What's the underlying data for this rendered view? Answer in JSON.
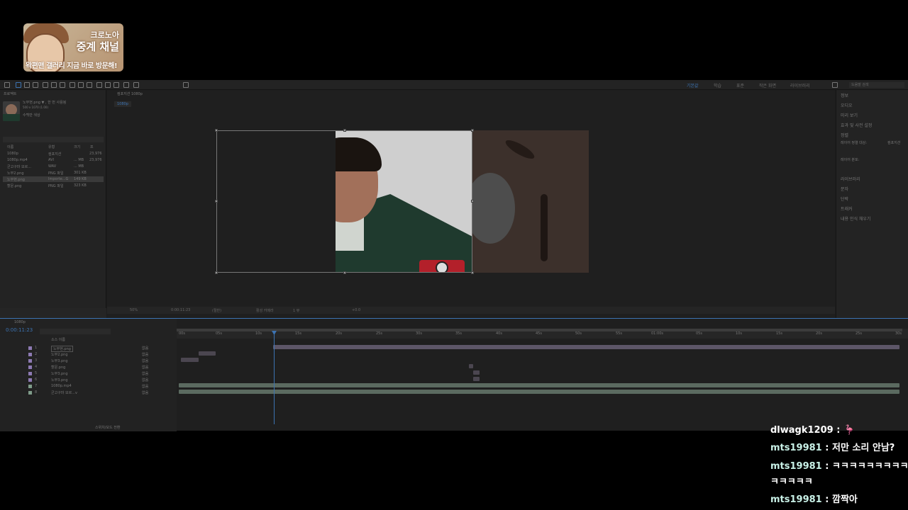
{
  "overlay": {
    "logo_line1": "크로노아",
    "logo_line2": "중계 채널",
    "logo_line3": "왁편맨 갤러리 지금 바로 방문해!"
  },
  "toolbar": {
    "workspaces": [
      "기본값",
      "학습",
      "표준",
      "작은 화면",
      "라이브러리"
    ],
    "active_workspace": "기본값",
    "search_placeholder": "도움말 검색"
  },
  "project_panel": {
    "title": "프로젝트",
    "selected_name": "노무현.png ▼ , 한 번 사용됨",
    "selected_info": "500 x 1070 (1.00)",
    "selected_sub": "수백만 색상",
    "columns": [
      "이름",
      "유형",
      "크기",
      "프"
    ],
    "items": [
      {
        "name": "1080p",
        "type": "컴포지션",
        "size": "",
        "dur": "23,976"
      },
      {
        "name": "1080p.mp4",
        "type": "AVI",
        "size": "... MB",
        "dur": "23,976"
      },
      {
        "name": "군고구마 모르...",
        "type": "WAV",
        "size": "... MB",
        "dur": ""
      },
      {
        "name": "노무2.png",
        "type": "PNG 파일",
        "size": "301 KB",
        "dur": ""
      },
      {
        "name": "노무현.png",
        "type": "Importe...G",
        "size": "149 KB",
        "dur": ""
      },
      {
        "name": "할문.png",
        "type": "PNG 파일",
        "size": "323 KB",
        "dur": ""
      }
    ]
  },
  "comp_panel": {
    "tab": "컴포지션 1080p",
    "crumb": "1080p",
    "zoom": "50%",
    "timecode": "0:00:11:23",
    "resolution": "(절반)",
    "camera": "활성 카메라",
    "views": "1 뷰",
    "offset": "+0.0"
  },
  "right_panel": {
    "items": [
      "정보",
      "오디오",
      "미리 보기",
      "효과 및 사전 설정",
      "정렬",
      "레이어 정렬 대상:",
      "컴포지션",
      "레이어 분포:",
      "라이브러리",
      "문자",
      "단락",
      "트래커",
      "내용 인식 채우기"
    ]
  },
  "timeline": {
    "tab": "1080p",
    "timecode": "0:00:11:23",
    "ruler": [
      "00s",
      "05s",
      "10s",
      "15s",
      "20s",
      "25s",
      "30s",
      "35s",
      "40s",
      "45s",
      "50s",
      "55s",
      "01:00s",
      "05s",
      "10s",
      "15s",
      "20s",
      "25s",
      "30s"
    ],
    "header": "소스 이름",
    "parent_label": "없음",
    "layers": [
      {
        "num": "1",
        "name": "노무현.png",
        "color": "#8d7ab3"
      },
      {
        "num": "2",
        "name": "노무2.png",
        "color": "#8d7ab3"
      },
      {
        "num": "3",
        "name": "노무3.png",
        "color": "#8d7ab3"
      },
      {
        "num": "4",
        "name": "할문.png",
        "color": "#8d7ab3"
      },
      {
        "num": "5",
        "name": "노무3.png",
        "color": "#8d7ab3"
      },
      {
        "num": "6",
        "name": "노무3.png",
        "color": "#8d7ab3"
      },
      {
        "num": "7",
        "name": "1080p.mp4",
        "color": "#7f9c8a"
      },
      {
        "num": "8",
        "name": "군고구마 모르...v",
        "color": "#7f9c8a"
      }
    ],
    "footer": "스위치/모드 전환"
  },
  "chat": [
    {
      "user": "dlwagk1209",
      "sep": " : ",
      "msg": "🦩",
      "color": "#ffffff"
    },
    {
      "user": "mts19981",
      "sep": " : ",
      "msg": "저만 소리 안남?",
      "color": "#c8f0e6"
    },
    {
      "user": "mts19981",
      "sep": " : ",
      "msg": "ㅋㅋㅋㅋㅋㅋㅋㅋㅋ",
      "color": "#c8f0e6"
    },
    {
      "user": "",
      "sep": "",
      "msg": "ㅋㅋㅋㅋㅋ",
      "color": "#ffffff"
    },
    {
      "user": "mts19981",
      "sep": " : ",
      "msg": "깜짝아",
      "color": "#c8f0e6"
    }
  ]
}
